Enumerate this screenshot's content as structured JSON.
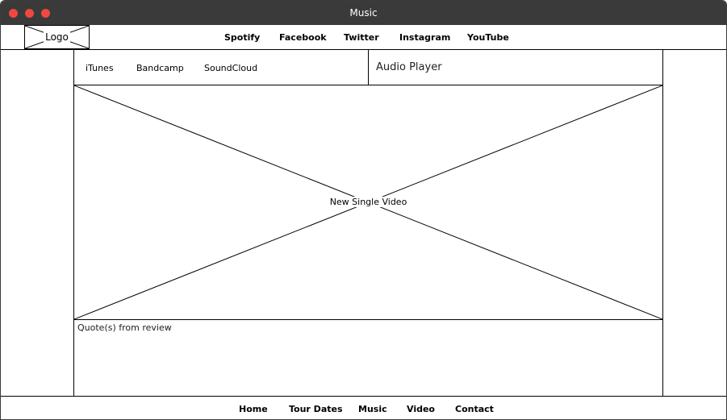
{
  "window": {
    "title": "Music"
  },
  "header": {
    "logo_label": "Logo",
    "nav": [
      "Spotify",
      "Facebook",
      "Twitter",
      "Instagram",
      "YouTube"
    ]
  },
  "stores": [
    "iTunes",
    "Bandcamp",
    "SoundCloud"
  ],
  "audio_player": {
    "label": "Audio Player"
  },
  "video": {
    "label": "New Single Video"
  },
  "reviews": {
    "label": "Quote(s) from review"
  },
  "footer": {
    "nav": [
      "Home",
      "Tour Dates",
      "Music",
      "Video",
      "Contact"
    ]
  },
  "colors": {
    "titlebar": "#3a3a3a",
    "close_dot": "#f0483e",
    "line": "#000000"
  }
}
